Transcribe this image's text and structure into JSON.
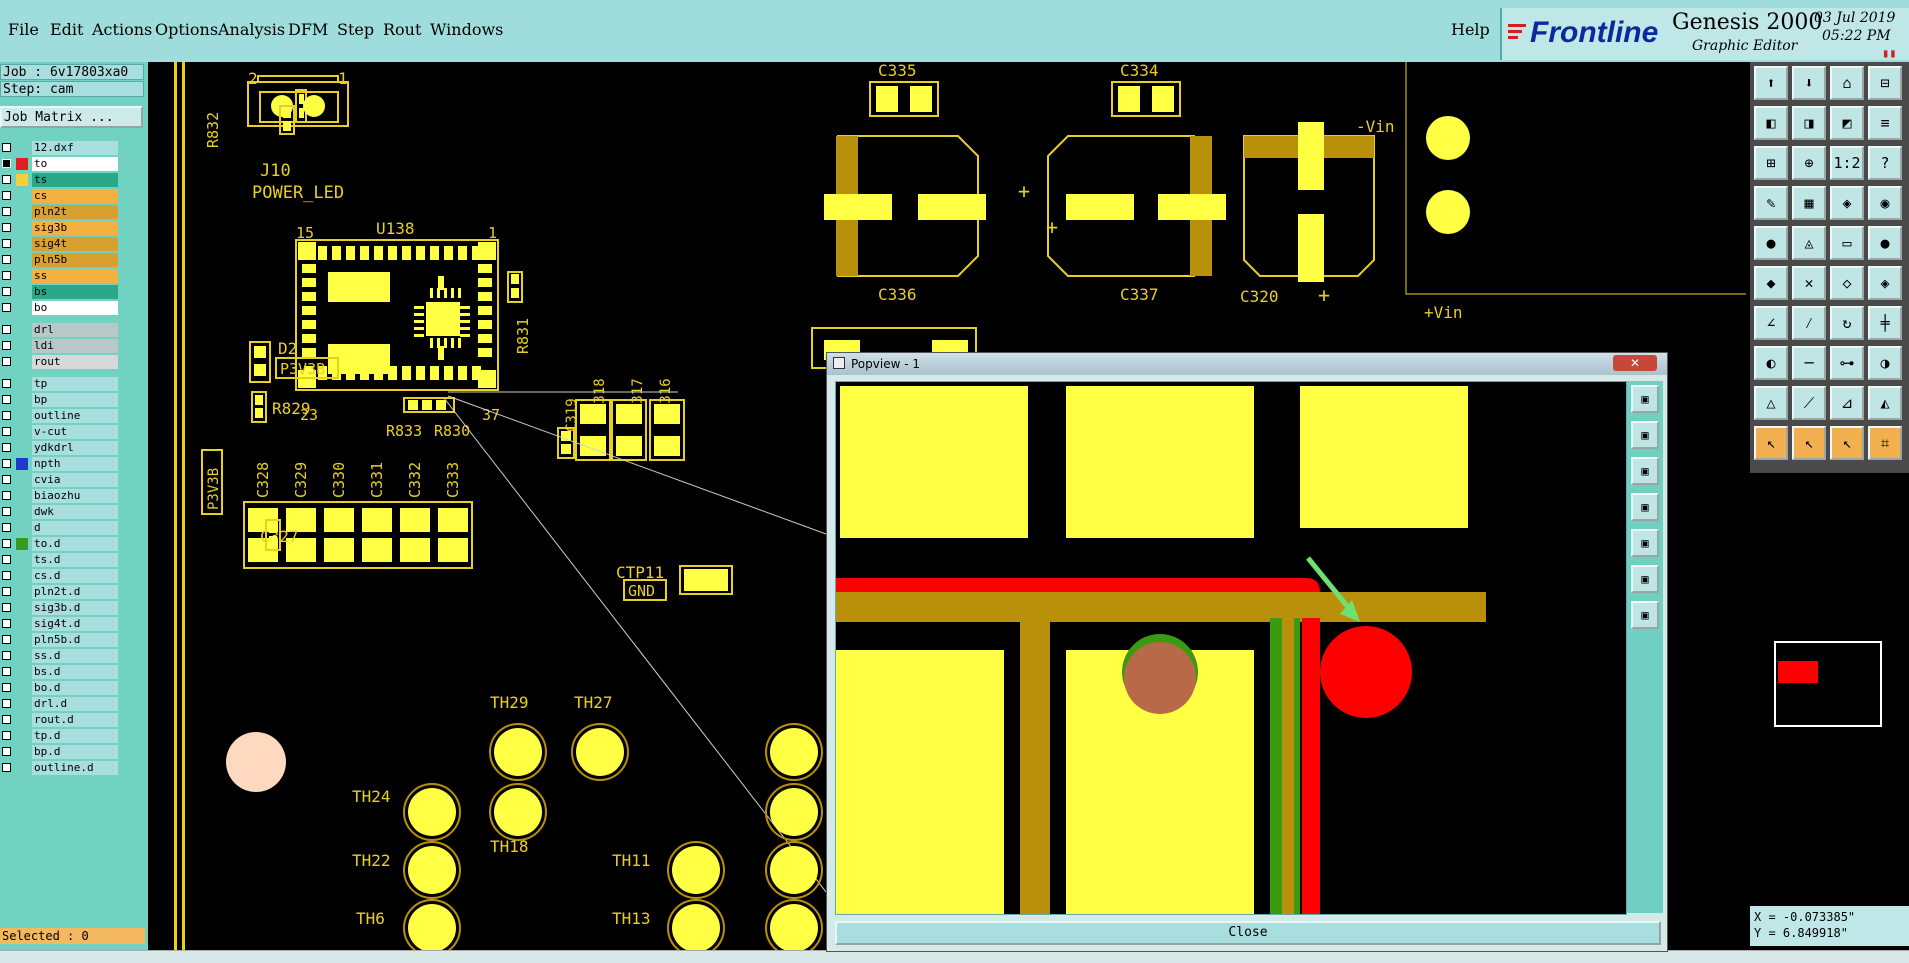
{
  "menu": {
    "items": [
      "File",
      "Edit",
      "Actions",
      "Options",
      "Analysis",
      "DFM",
      "Step",
      "Rout",
      "Windows"
    ],
    "help": "Help"
  },
  "brand": {
    "logo": "Frontline",
    "product": "Genesis 2000",
    "subtitle": "Graphic Editor",
    "date": "03 Jul 2019",
    "time": "05:22 PM"
  },
  "job": {
    "job_label": "Job : 6v17803xa0",
    "step_label": "Step: cam",
    "matrix_button": "Job Matrix ...",
    "selected": "Selected : 0"
  },
  "layers": [
    {
      "name": "12.dxf",
      "color": "#a9dede",
      "swatch": "",
      "checked": false
    },
    {
      "name": "to",
      "color": "#ffffff",
      "swatch": "#e02020",
      "checked": true
    },
    {
      "name": "ts",
      "color": "#2aa88a",
      "swatch": "#f4d03a",
      "checked": false
    },
    {
      "name": "cs",
      "color": "#f4b040",
      "swatch": "",
      "checked": false
    },
    {
      "name": "pln2t",
      "color": "#d8a030",
      "swatch": "",
      "checked": false
    },
    {
      "name": "sig3b",
      "color": "#f4b040",
      "swatch": "",
      "checked": false
    },
    {
      "name": "sig4t",
      "color": "#d8a030",
      "swatch": "",
      "checked": false
    },
    {
      "name": "pln5b",
      "color": "#d8a030",
      "swatch": "",
      "checked": false
    },
    {
      "name": "ss",
      "color": "#f4b040",
      "swatch": "",
      "checked": false
    },
    {
      "name": "bs",
      "color": "#2aa88a",
      "swatch": "",
      "checked": false
    },
    {
      "name": "bo",
      "color": "#ffffff",
      "swatch": "",
      "checked": false
    },
    {
      "name": "drl",
      "color": "#b8c8c8",
      "swatch": "",
      "checked": false
    },
    {
      "name": "ldi",
      "color": "#b8c8c8",
      "swatch": "",
      "checked": false
    },
    {
      "name": "rout",
      "color": "#d8d8d8",
      "swatch": "",
      "checked": false
    },
    {
      "name": "tp",
      "color": "#a9dede",
      "swatch": "",
      "checked": false
    },
    {
      "name": "bp",
      "color": "#a9dede",
      "swatch": "",
      "checked": false
    },
    {
      "name": "outline",
      "color": "#a9dede",
      "swatch": "",
      "checked": false
    },
    {
      "name": "v-cut",
      "color": "#a9dede",
      "swatch": "",
      "checked": false
    },
    {
      "name": "ydkdrl",
      "color": "#a9dede",
      "swatch": "",
      "checked": false
    },
    {
      "name": "npth",
      "color": "#a9dede",
      "swatch": "#1a3ad0",
      "checked": false
    },
    {
      "name": "cvia",
      "color": "#a9dede",
      "swatch": "",
      "checked": false
    },
    {
      "name": "biaozhu",
      "color": "#a9dede",
      "swatch": "",
      "checked": false
    },
    {
      "name": "dwk",
      "color": "#a9dede",
      "swatch": "",
      "checked": false
    },
    {
      "name": "d",
      "color": "#a9dede",
      "swatch": "",
      "checked": false
    },
    {
      "name": "to.d",
      "color": "#a9dede",
      "swatch": "#3a9a20",
      "checked": false
    },
    {
      "name": "ts.d",
      "color": "#a9dede",
      "swatch": "",
      "checked": false
    },
    {
      "name": "cs.d",
      "color": "#a9dede",
      "swatch": "",
      "checked": false
    },
    {
      "name": "pln2t.d",
      "color": "#a9dede",
      "swatch": "",
      "checked": false
    },
    {
      "name": "sig3b.d",
      "color": "#a9dede",
      "swatch": "",
      "checked": false
    },
    {
      "name": "sig4t.d",
      "color": "#a9dede",
      "swatch": "",
      "checked": false
    },
    {
      "name": "pln5b.d",
      "color": "#a9dede",
      "swatch": "",
      "checked": false
    },
    {
      "name": "ss.d",
      "color": "#a9dede",
      "swatch": "",
      "checked": false
    },
    {
      "name": "bs.d",
      "color": "#a9dede",
      "swatch": "",
      "checked": false
    },
    {
      "name": "bo.d",
      "color": "#a9dede",
      "swatch": "",
      "checked": false
    },
    {
      "name": "drl.d",
      "color": "#a9dede",
      "swatch": "",
      "checked": false
    },
    {
      "name": "rout.d",
      "color": "#a9dede",
      "swatch": "",
      "checked": false
    },
    {
      "name": "tp.d",
      "color": "#a9dede",
      "swatch": "",
      "checked": false
    },
    {
      "name": "bp.d",
      "color": "#a9dede",
      "swatch": "",
      "checked": false
    },
    {
      "name": "outline.d",
      "color": "#a9dede",
      "swatch": "",
      "checked": false
    }
  ],
  "pcb_labels": {
    "r832": "R832",
    "j10": "J10",
    "power_led": "POWER_LED",
    "pin2": "2",
    "pin1": "1",
    "u138": "U138",
    "u_pin15": "15",
    "u_pin1": "1",
    "u_pin23": "23",
    "u_pin37": "37",
    "r831": "R831",
    "d2": "D2",
    "p3v3b_a": "P3V3B",
    "p3v3b_b": "P3V3B",
    "r829": "R829",
    "r833": "R833",
    "r830": "R830",
    "c319": "C319",
    "c318": "C318",
    "c317": "C317",
    "c316": "C316",
    "c328": "C328",
    "c329": "C329",
    "c330": "C330",
    "c331": "C331",
    "c332": "C332",
    "c333": "C333",
    "c327": "C327",
    "ctp11": "CTP11",
    "gnd": "GND",
    "c335": "C335",
    "c334": "C334",
    "c336": "C336",
    "c337": "C337",
    "c320": "C320",
    "minus_vin": "-Vin",
    "plus_vin": "+Vin",
    "th29": "TH29",
    "th27": "TH27",
    "th24": "TH24",
    "th18": "TH18",
    "th22": "TH22",
    "th11": "TH11",
    "th6": "TH6",
    "th13": "TH13"
  },
  "popview": {
    "title": "Popview - 1",
    "close_button": "Close"
  },
  "coords": {
    "x": "X = -0.073385\"",
    "y": "Y = 6.849918\""
  },
  "colors": {
    "pad_yellow": "#ffff44",
    "silk_yellow": "#e8d020",
    "trace_gold": "#b8900a",
    "highlight_red": "#ff0000",
    "green": "#3a9a10",
    "arrow_green": "#70e070"
  }
}
